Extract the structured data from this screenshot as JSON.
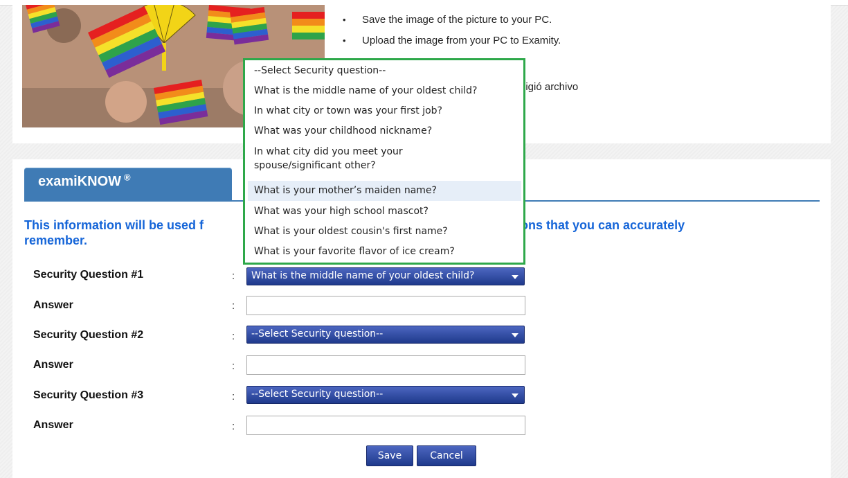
{
  "instructions": [
    {
      "bullet": "•",
      "text": "Save the image of the picture to your PC."
    },
    {
      "bullet": "•",
      "text": "Upload the image from your PC to Examity."
    }
  ],
  "file_status_fragment": "ligió archivo",
  "tab": {
    "label": "examiKNOW",
    "mark": "®"
  },
  "info_text": {
    "left": "This information will be used f",
    "right": "estions that you can accurately",
    "line2": "remember."
  },
  "form": {
    "q1_label": "Security Question #1",
    "q1_value": "What is the middle name of your oldest child?",
    "answer_label": "Answer",
    "q2_label": "Security Question #2",
    "q2_value": "--Select Security question--",
    "q3_label": "Security Question #3",
    "q3_value": "--Select Security question--",
    "colon": ":"
  },
  "buttons": {
    "save": "Save",
    "cancel": "Cancel"
  },
  "dropdown_options": [
    "--Select Security question--",
    "What is the middle name of your oldest child?",
    "In what city or town was your first job?",
    "What was your childhood nickname?",
    "In what city did you meet your spouse/significant other?",
    "What is your mother’s maiden name?",
    "What was your high school mascot?",
    "What is your oldest cousin's first name?",
    "What is your favorite flavor of ice cream?"
  ],
  "dropdown_highlighted_index": 5,
  "colors": {
    "accent": "#3f7bb5",
    "info_text": "#1565d8",
    "dropdown_border": "#2ea84a",
    "select_bg": "#2b4aa6"
  }
}
